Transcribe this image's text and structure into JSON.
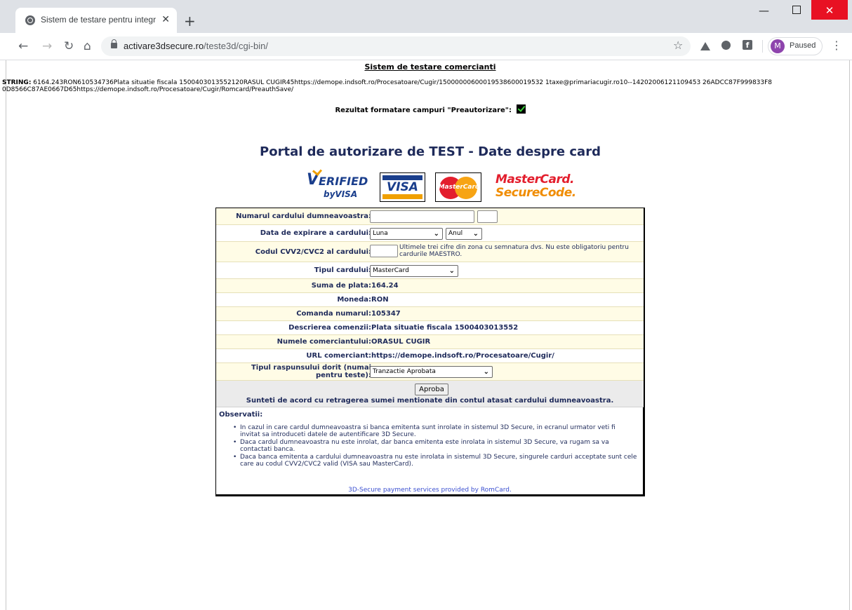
{
  "browser": {
    "tab_title": "Sistem de testare pentru integrar",
    "tab_close": "✕",
    "new_tab": "+",
    "url_host": "activare3dsecure.ro",
    "url_path": "/teste3d/cgi-bin/",
    "profile_initial": "M",
    "profile_status": "Paused",
    "window_buttons": {
      "minimize": "—",
      "close": "✕"
    },
    "icons": [
      "back-arrow-icon",
      "forward-arrow-icon",
      "reload-icon",
      "home-icon",
      "lock-icon",
      "star-icon",
      "drive-icon",
      "circle-extension-icon",
      "facebook-icon",
      "menu-dots-icon"
    ]
  },
  "page": {
    "header_title": "Sistem de testare comercianti",
    "string_label": "STRING:",
    "string_value": "6164.243RON610534736Plata situatie fiscala 1500403013552120RASUL CUGIR45https://demope.indsoft.ro/Procesatoare/Cugir/15000000600019538600019532 1taxe@primariacugir.ro10--14202006121109453 26ADCC87F999833F80D8566C87AE0667D65https://demope.indsoft.ro/Procesatoare/Cugir/Romcard/PreauthSave/",
    "rezultat_label": "Rezultat formatare campuri \"Preautorizare\":",
    "portal_title": "Portal de autorizare de TEST - Date despre card",
    "logos": {
      "vbv_line1": "ERIFIED",
      "vbv_line2_prefix": "by",
      "vbv_line2": "VISA",
      "visa": "VISA",
      "mastercard": "MasterCard",
      "securecode_line1": "MasterCard.",
      "securecode_line2": "SecureCode."
    }
  },
  "form": {
    "card_number_label": "Numarul cardului dumneavoastra:",
    "card_number_value": "",
    "expiry_label": "Data de expirare a cardului:",
    "expiry_month": "Luna",
    "expiry_year": "Anul",
    "cvv_label": "Codul CVV2/CVC2 al cardului:",
    "cvv_value": "",
    "cvv_note": "Ultimele trei cifre din zona cu semnatura dvs. Nu este obligatoriu pentru cardurile MAESTRO.",
    "card_type_label": "Tipul cardului:",
    "card_type_value": "MasterCard",
    "amount_label": "Suma de plata:",
    "amount_value": "164.24",
    "currency_label": "Moneda:",
    "currency_value": "RON",
    "order_label": "Comanda numarul:",
    "order_value": "105347",
    "description_label": "Descrierea comenzii:",
    "description_value": "Plata situatie fiscala 1500403013552",
    "merchant_label": "Numele comerciantului:",
    "merchant_value": "ORASUL CUGIR",
    "merchant_url_label": "URL comerciant:",
    "merchant_url_value": "https://demope.indsoft.ro/Procesatoare/Cugir/",
    "response_type_label_1": "Tipul raspunsului dorit (numai",
    "response_type_label_2": "pentru teste):",
    "response_type_value": "Tranzactie Aprobata",
    "approve_button": "Aproba",
    "agreement_text": "Sunteti de acord cu retragerea sumei mentionate din contul atasat cardului dumneavoastra.",
    "observations_title": "Observatii:",
    "observations": [
      "In cazul in care cardul dumneavoastra si banca emitenta sunt inrolate in sistemul 3D Secure, in ecranul urmator veti fi invitat sa introduceti datele de autentificare 3D Secure.",
      "Daca cardul dumneavoastra nu este inrolat, dar banca emitenta este inrolata in sistemul 3D Secure, va rugam sa va contactati banca.",
      "Daca banca emitenta a cardului dumneavoastra nu este inrolata in sistemul 3D Secure, singurele carduri acceptate sunt cele care au codul CVV2/CVC2 valid (VISA sau MasterCard)."
    ],
    "footer_link": "3D-Secure payment services provided by RomCard."
  },
  "colors": {
    "row_highlight": "#fffce6",
    "label_text": "#1e2a5a",
    "link_blue": "#3a4fd0",
    "close_button_red": "#e81123"
  }
}
